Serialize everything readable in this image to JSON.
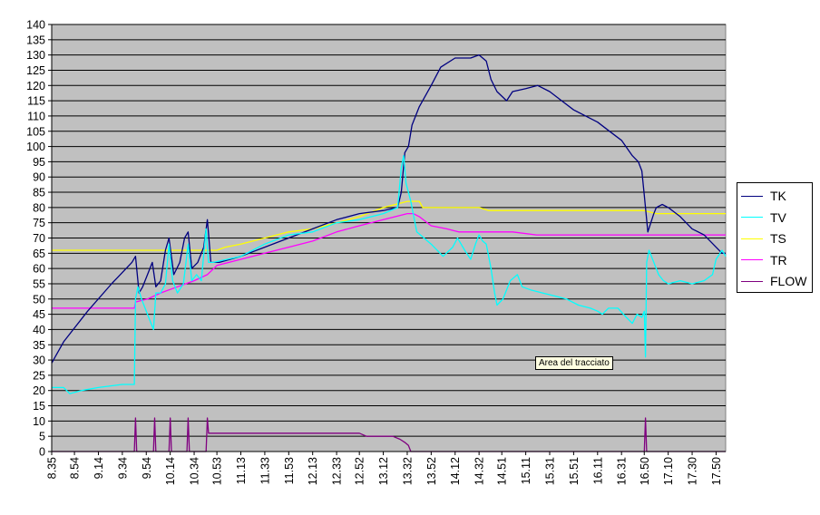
{
  "chart_data": {
    "type": "line",
    "title": "",
    "xlabel": "",
    "ylabel": "",
    "ylim": [
      0,
      140
    ],
    "yticks": [
      0,
      5,
      10,
      15,
      20,
      25,
      30,
      35,
      40,
      45,
      50,
      55,
      60,
      65,
      70,
      75,
      80,
      85,
      90,
      95,
      100,
      105,
      110,
      115,
      120,
      125,
      130,
      135,
      140
    ],
    "xlim": [
      "8.35",
      "17.58"
    ],
    "x_tick_labels": [
      "8.35",
      "8.54",
      "9.14",
      "9.34",
      "9.54",
      "10.14",
      "10.34",
      "10.53",
      "11.13",
      "11.33",
      "11.53",
      "12.13",
      "12.33",
      "12.52",
      "13.12",
      "13.32",
      "13.52",
      "14.12",
      "14.32",
      "14.51",
      "15.11",
      "15.31",
      "15.51",
      "16.11",
      "16.31",
      "16.50",
      "17.10",
      "17.30",
      "17.50"
    ],
    "grid": true,
    "legend_position": "right",
    "background": "#c0c0c0",
    "series": [
      {
        "name": "TK",
        "color": "#000080",
        "points": [
          [
            "8.35",
            29
          ],
          [
            "8.45",
            36
          ],
          [
            "9.05",
            46
          ],
          [
            "9.25",
            55
          ],
          [
            "9.42",
            62
          ],
          [
            "9.45",
            64
          ],
          [
            "9.48",
            52
          ],
          [
            "9.51",
            54
          ],
          [
            "9.55",
            58
          ],
          [
            "9.59",
            62
          ],
          [
            "10.02",
            54
          ],
          [
            "10.06",
            56
          ],
          [
            "10.10",
            66
          ],
          [
            "10.13",
            70
          ],
          [
            "10.17",
            58
          ],
          [
            "10.22",
            62
          ],
          [
            "10.26",
            70
          ],
          [
            "10.29",
            72
          ],
          [
            "10.32",
            60
          ],
          [
            "10.37",
            62
          ],
          [
            "10.42",
            67
          ],
          [
            "10.45",
            76
          ],
          [
            "10.48",
            62
          ],
          [
            "10.55",
            62
          ],
          [
            "11.13",
            64
          ],
          [
            "11.33",
            67
          ],
          [
            "11.53",
            70
          ],
          [
            "12.13",
            73
          ],
          [
            "12.33",
            76
          ],
          [
            "12.52",
            78
          ],
          [
            "13.12",
            79
          ],
          [
            "13.24",
            80
          ],
          [
            "13.27",
            85
          ],
          [
            "13.30",
            98
          ],
          [
            "13.33",
            100
          ],
          [
            "13.36",
            107
          ],
          [
            "13.42",
            113
          ],
          [
            "13.52",
            120
          ],
          [
            "14.00",
            126
          ],
          [
            "14.12",
            129
          ],
          [
            "14.25",
            129
          ],
          [
            "14.32",
            130
          ],
          [
            "14.38",
            128
          ],
          [
            "14.42",
            122
          ],
          [
            "14.47",
            118
          ],
          [
            "14.55",
            115
          ],
          [
            "15.00",
            118
          ],
          [
            "15.11",
            119
          ],
          [
            "15.21",
            120
          ],
          [
            "15.31",
            118
          ],
          [
            "15.41",
            115
          ],
          [
            "15.51",
            112
          ],
          [
            "16.01",
            110
          ],
          [
            "16.11",
            108
          ],
          [
            "16.21",
            105
          ],
          [
            "16.31",
            102
          ],
          [
            "16.40",
            97
          ],
          [
            "16.45",
            95
          ],
          [
            "16.48",
            92
          ],
          [
            "16.50",
            84
          ],
          [
            "16.53",
            72
          ],
          [
            "16.58",
            78
          ],
          [
            "17.00",
            80
          ],
          [
            "17.05",
            81
          ],
          [
            "17.10",
            80
          ],
          [
            "17.20",
            77
          ],
          [
            "17.30",
            73
          ],
          [
            "17.40",
            71
          ],
          [
            "17.50",
            67
          ],
          [
            "17.55",
            65
          ],
          [
            "17.58",
            65
          ]
        ]
      },
      {
        "name": "TV",
        "color": "#00ffff",
        "points": [
          [
            "8.35",
            21
          ],
          [
            "8.45",
            21
          ],
          [
            "8.50",
            19
          ],
          [
            "9.00",
            20
          ],
          [
            "9.14",
            21
          ],
          [
            "9.34",
            22
          ],
          [
            "9.44",
            22
          ],
          [
            "9.45",
            50
          ],
          [
            "9.47",
            54
          ],
          [
            "9.50",
            50
          ],
          [
            "9.55",
            45
          ],
          [
            "9.58",
            42
          ],
          [
            "10.00",
            40
          ],
          [
            "10.02",
            52
          ],
          [
            "10.06",
            52
          ],
          [
            "10.10",
            55
          ],
          [
            "10.13",
            68
          ],
          [
            "10.16",
            56
          ],
          [
            "10.20",
            52
          ],
          [
            "10.25",
            55
          ],
          [
            "10.29",
            68
          ],
          [
            "10.32",
            56
          ],
          [
            "10.36",
            58
          ],
          [
            "10.40",
            56
          ],
          [
            "10.44",
            73
          ],
          [
            "10.46",
            62
          ],
          [
            "10.50",
            62
          ],
          [
            "11.13",
            64
          ],
          [
            "11.33",
            68
          ],
          [
            "11.53",
            71
          ],
          [
            "12.13",
            72
          ],
          [
            "12.33",
            75
          ],
          [
            "12.52",
            76
          ],
          [
            "13.12",
            78
          ],
          [
            "13.24",
            80
          ],
          [
            "13.27",
            93
          ],
          [
            "13.29",
            97
          ],
          [
            "13.31",
            88
          ],
          [
            "13.35",
            82
          ],
          [
            "13.40",
            72
          ],
          [
            "13.52",
            68
          ],
          [
            "14.02",
            64
          ],
          [
            "14.10",
            67
          ],
          [
            "14.14",
            70
          ],
          [
            "14.20",
            66
          ],
          [
            "14.25",
            63
          ],
          [
            "14.29",
            68
          ],
          [
            "14.32",
            71
          ],
          [
            "14.35",
            69
          ],
          [
            "14.38",
            68
          ],
          [
            "14.42",
            60
          ],
          [
            "14.45",
            52
          ],
          [
            "14.47",
            48
          ],
          [
            "14.52",
            50
          ],
          [
            "14.58",
            56
          ],
          [
            "15.04",
            58
          ],
          [
            "15.08",
            54
          ],
          [
            "15.15",
            53
          ],
          [
            "15.25",
            52
          ],
          [
            "15.35",
            51
          ],
          [
            "15.45",
            50
          ],
          [
            "15.55",
            48
          ],
          [
            "16.05",
            47
          ],
          [
            "16.11",
            46
          ],
          [
            "16.15",
            45
          ],
          [
            "16.20",
            47
          ],
          [
            "16.28",
            47
          ],
          [
            "16.35",
            44
          ],
          [
            "16.40",
            42
          ],
          [
            "16.44",
            45
          ],
          [
            "16.48",
            44
          ],
          [
            "16.50",
            46
          ],
          [
            "16.51",
            31
          ],
          [
            "16.52",
            62
          ],
          [
            "16.54",
            66
          ],
          [
            "16.58",
            62
          ],
          [
            "17.02",
            58
          ],
          [
            "17.06",
            56
          ],
          [
            "17.10",
            55
          ],
          [
            "17.20",
            56
          ],
          [
            "17.30",
            55
          ],
          [
            "17.40",
            56
          ],
          [
            "17.47",
            58
          ],
          [
            "17.50",
            63
          ],
          [
            "17.55",
            66
          ],
          [
            "17.58",
            64
          ]
        ]
      },
      {
        "name": "TS",
        "color": "#ffff00",
        "points": [
          [
            "8.35",
            66
          ],
          [
            "9.34",
            66
          ],
          [
            "10.53",
            66
          ],
          [
            "11.00",
            67
          ],
          [
            "11.13",
            68
          ],
          [
            "11.33",
            70
          ],
          [
            "11.53",
            72
          ],
          [
            "12.13",
            73
          ],
          [
            "12.33",
            75
          ],
          [
            "12.52",
            77
          ],
          [
            "13.12",
            80
          ],
          [
            "13.32",
            82
          ],
          [
            "13.42",
            82
          ],
          [
            "13.45",
            80
          ],
          [
            "14.12",
            80
          ],
          [
            "14.32",
            80
          ],
          [
            "14.40",
            79
          ],
          [
            "14.45",
            79
          ],
          [
            "15.11",
            79
          ],
          [
            "15.31",
            79
          ],
          [
            "15.51",
            79
          ],
          [
            "16.11",
            79
          ],
          [
            "16.31",
            79
          ],
          [
            "16.50",
            79
          ],
          [
            "17.00",
            78
          ],
          [
            "17.20",
            78
          ],
          [
            "17.40",
            78
          ],
          [
            "17.58",
            78
          ]
        ]
      },
      {
        "name": "TR",
        "color": "#ff00ff",
        "points": [
          [
            "8.35",
            47
          ],
          [
            "9.34",
            47
          ],
          [
            "9.44",
            47
          ],
          [
            "9.45",
            49
          ],
          [
            "9.55",
            50
          ],
          [
            "10.06",
            52
          ],
          [
            "10.20",
            54
          ],
          [
            "10.34",
            56
          ],
          [
            "10.45",
            58
          ],
          [
            "10.53",
            61
          ],
          [
            "11.13",
            63
          ],
          [
            "11.33",
            65
          ],
          [
            "11.53",
            67
          ],
          [
            "12.13",
            69
          ],
          [
            "12.33",
            72
          ],
          [
            "12.52",
            74
          ],
          [
            "13.12",
            76
          ],
          [
            "13.32",
            78
          ],
          [
            "13.37",
            78
          ],
          [
            "13.42",
            77
          ],
          [
            "13.52",
            74
          ],
          [
            "14.05",
            73
          ],
          [
            "14.15",
            72
          ],
          [
            "14.32",
            72
          ],
          [
            "14.42",
            72
          ],
          [
            "15.00",
            72
          ],
          [
            "15.20",
            71
          ],
          [
            "15.40",
            71
          ],
          [
            "16.11",
            71
          ],
          [
            "16.31",
            71
          ],
          [
            "16.50",
            71
          ],
          [
            "17.10",
            71
          ],
          [
            "17.30",
            71
          ],
          [
            "17.58",
            71
          ]
        ]
      },
      {
        "name": "FLOW",
        "color": "#800080",
        "points": [
          [
            "8.35",
            0
          ],
          [
            "9.44",
            0
          ],
          [
            "9.45",
            11
          ],
          [
            "9.46",
            0
          ],
          [
            "10.00",
            0
          ],
          [
            "10.01",
            11
          ],
          [
            "10.02",
            0
          ],
          [
            "10.13",
            0
          ],
          [
            "10.14",
            11
          ],
          [
            "10.15",
            0
          ],
          [
            "10.28",
            0
          ],
          [
            "10.29",
            11
          ],
          [
            "10.30",
            0
          ],
          [
            "10.44",
            0
          ],
          [
            "10.45",
            11
          ],
          [
            "10.46",
            6
          ],
          [
            "11.13",
            6
          ],
          [
            "11.33",
            6
          ],
          [
            "11.53",
            6
          ],
          [
            "12.13",
            6
          ],
          [
            "12.33",
            6
          ],
          [
            "12.52",
            6
          ],
          [
            "12.58",
            5
          ],
          [
            "13.05",
            5
          ],
          [
            "13.12",
            5
          ],
          [
            "13.20",
            5
          ],
          [
            "13.26",
            4
          ],
          [
            "13.30",
            3
          ],
          [
            "13.33",
            2
          ],
          [
            "13.35",
            0
          ],
          [
            "16.50",
            0
          ],
          [
            "16.51",
            11
          ],
          [
            "16.52",
            0
          ],
          [
            "17.58",
            0
          ]
        ]
      }
    ],
    "annotation": "Area del tracciato"
  }
}
